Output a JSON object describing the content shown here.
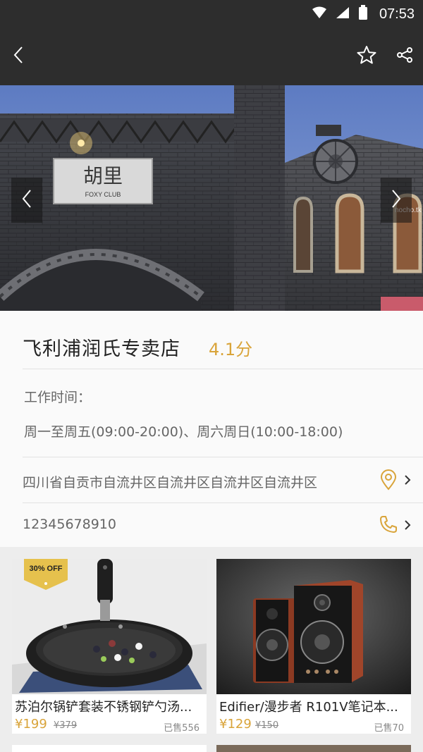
{
  "status_bar": {
    "time": "07:53"
  },
  "app_bar": {
    "back_icon": "back-arrow-icon",
    "favorite_icon": "star-icon",
    "share_icon": "share-icon"
  },
  "hero": {
    "sign_text_main": "胡里",
    "sign_text_sub": "FOXY CLUB",
    "watermark": "nocho.tk"
  },
  "shop": {
    "name": "飞利浦润氏专卖店",
    "score": "4.1分",
    "hours_label": "工作时间：",
    "hours_value": "周一至周五(09:00-20:00)、周六周日(10:00-18:00)",
    "address": "四川省自贡市自流井区自流井区自流井区自流井区",
    "phone": "12345678910"
  },
  "products": [
    {
      "badge": "30% OFF",
      "title": "苏泊尔锅铲套装不锈钢铲勺汤...",
      "price": "¥199",
      "old_price": "¥379",
      "sold": "已售556"
    },
    {
      "badge": "",
      "title": "Edifier/漫步者 R101V笔记本...",
      "price": "¥129",
      "old_price": "¥150",
      "sold": "已售70"
    }
  ],
  "colors": {
    "bar": "#2d2d2d",
    "accent": "#d9a43a"
  }
}
